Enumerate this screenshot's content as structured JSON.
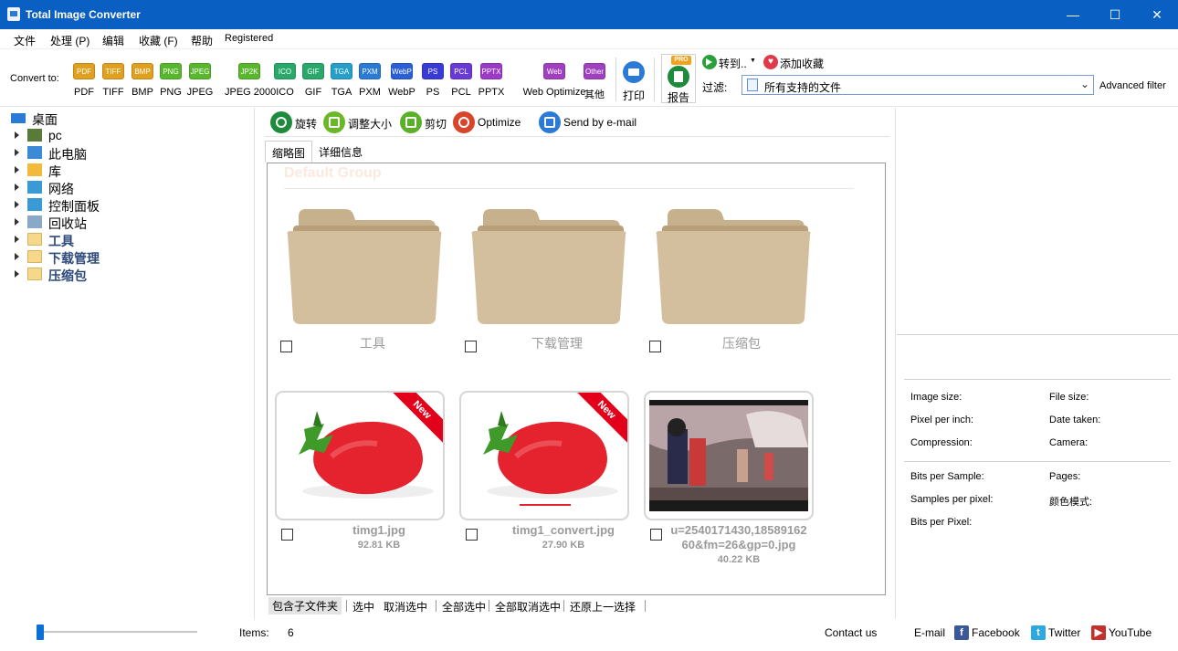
{
  "window": {
    "title": "Total Image Converter",
    "controls": [
      "—",
      "☐",
      "✕"
    ]
  },
  "menu": [
    {
      "label": "文件"
    },
    {
      "label": "处理 (P)"
    },
    {
      "label": "编辑"
    },
    {
      "label": "收藏 (F)"
    },
    {
      "label": "帮助"
    },
    {
      "label": "Registered"
    }
  ],
  "toolbar": {
    "convert_label": "Convert to:",
    "formats": [
      {
        "icon": "PDF",
        "label": "PDF",
        "color": "#e0a020"
      },
      {
        "icon": "TIFF",
        "label": "TIFF",
        "color": "#e0a020"
      },
      {
        "icon": "BMP",
        "label": "BMP",
        "color": "#e0a020"
      },
      {
        "icon": "PNG",
        "label": "PNG",
        "color": "#59b72d"
      },
      {
        "icon": "JPEG",
        "label": "JPEG",
        "color": "#59b72d"
      },
      {
        "icon": "JP2K",
        "label": "JPEG 2000",
        "color": "#59b72d"
      },
      {
        "icon": "ICO",
        "label": "ICO",
        "color": "#2aa86a"
      },
      {
        "icon": "GIF",
        "label": "GIF",
        "color": "#2aa86a"
      },
      {
        "icon": "TGA",
        "label": "TGA",
        "color": "#27a0c9"
      },
      {
        "icon": "PXM",
        "label": "PXM",
        "color": "#2a7ad6"
      },
      {
        "icon": "WebP",
        "label": "WebP",
        "color": "#2a5fd6"
      },
      {
        "icon": "PS",
        "label": "PS",
        "color": "#3a3ad6"
      },
      {
        "icon": "PCL",
        "label": "PCL",
        "color": "#6a3ad6"
      },
      {
        "icon": "PPTX",
        "label": "PPTX",
        "color": "#9a3ac6"
      },
      {
        "icon": "Web",
        "label": "Web Optimize",
        "color": "#a040c0"
      },
      {
        "icon": "Other",
        "label": "其他",
        "color": "#a040c0"
      }
    ],
    "print_label": "打印",
    "report_label": "报告",
    "report_badge": "PRO",
    "goto_label": "转到..",
    "add_fav_label": "添加收藏",
    "filter_label": "过滤:",
    "filter_value": "所有支持的文件",
    "advanced_filter": "Advanced filter"
  },
  "tree": {
    "items": [
      {
        "label": "桌面",
        "icon": "desktop-icon"
      },
      {
        "label": "pc",
        "icon": "user-icon"
      },
      {
        "label": "此电脑",
        "icon": "computer-icon"
      },
      {
        "label": "库",
        "icon": "library-icon"
      },
      {
        "label": "网络",
        "icon": "network-icon"
      },
      {
        "label": "控制面板",
        "icon": "control-panel-icon"
      },
      {
        "label": "回收站",
        "icon": "recycle-bin-icon"
      },
      {
        "label": "工具",
        "icon": "folder-icon"
      },
      {
        "label": "下载管理",
        "icon": "folder-icon"
      },
      {
        "label": "压缩包",
        "icon": "folder-icon"
      }
    ]
  },
  "actions": [
    {
      "label": "旋转",
      "color": "#1e8a3c",
      "icon": "rotate-icon"
    },
    {
      "label": "调整大小",
      "color": "#6ab82a",
      "icon": "resize-icon"
    },
    {
      "label": "剪切",
      "color": "#5bb02a",
      "icon": "crop-icon"
    },
    {
      "label": "Optimize",
      "color": "#d8452a",
      "icon": "optimize-icon"
    },
    {
      "label": "Send by e-mail",
      "color": "#2a7ad6",
      "icon": "email-icon"
    }
  ],
  "tabs": [
    {
      "label": "缩略图"
    },
    {
      "label": "详细信息"
    }
  ],
  "content": {
    "group_title": "Default Group",
    "folders": [
      {
        "name": "工具"
      },
      {
        "name": "下载管理"
      },
      {
        "name": "压缩包"
      }
    ],
    "files": [
      {
        "name": "timg1.jpg",
        "size": "92.81 KB",
        "badge": "New"
      },
      {
        "name": "timg1_convert.jpg",
        "size": "27.90 KB",
        "badge": "New"
      },
      {
        "name": "u=2540171430,1858916260&fm=26&gp=0.jpg",
        "name_line1": "u=2540171430,18589162",
        "name_line2": "60&fm=26&gp=0.jpg",
        "size": "40.22 KB",
        "badge": ""
      }
    ]
  },
  "selection_bar": [
    {
      "label": "包含子文件夹"
    },
    {
      "label": "选中"
    },
    {
      "label": "取消选中"
    },
    {
      "label": "全部选中"
    },
    {
      "label": "全部取消选中"
    },
    {
      "label": "还原上一选择"
    }
  ],
  "info_panel": {
    "left_col": [
      "Image size:",
      "Pixel per inch:",
      "Compression:",
      "Bits per Sample:",
      "Samples per pixel:",
      "Bits per Pixel:"
    ],
    "right_col": [
      "File size:",
      "Date taken:",
      "Camera:",
      "Pages:",
      "颜色模式:"
    ]
  },
  "status": {
    "items_label": "Items:",
    "items_count": "6",
    "zoom_value": 0,
    "contact": "Contact us",
    "email": "E-mail",
    "facebook": "Facebook",
    "twitter": "Twitter",
    "youtube": "YouTube"
  }
}
